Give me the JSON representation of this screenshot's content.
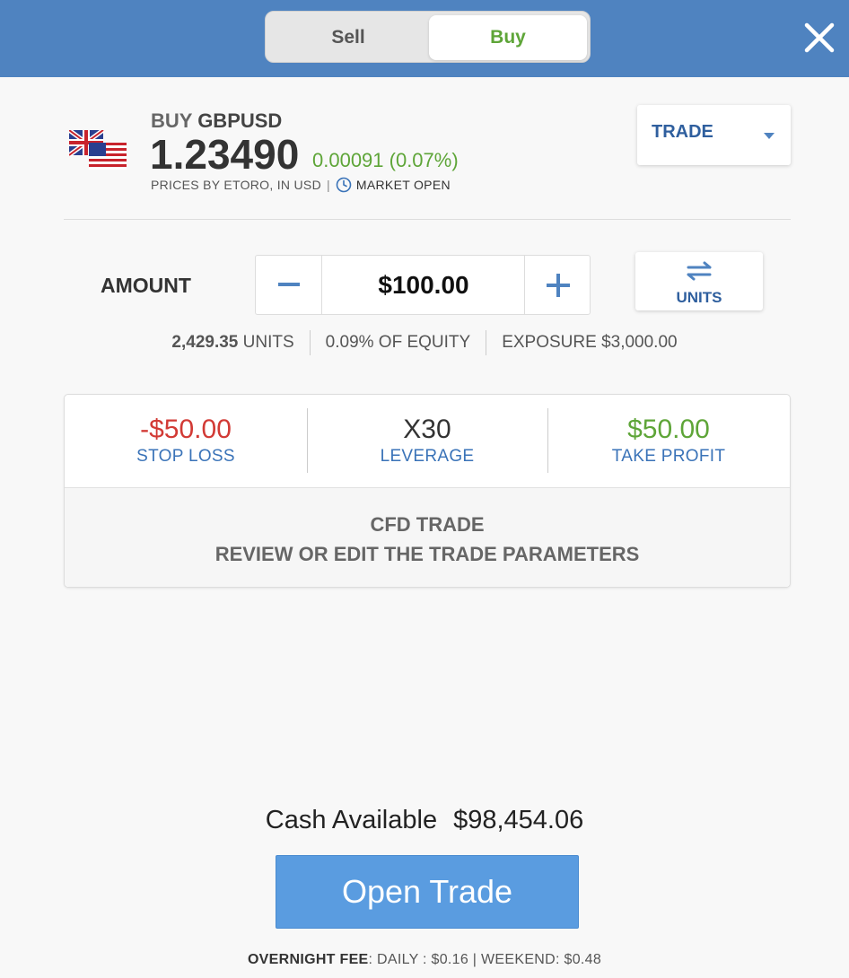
{
  "header": {
    "sell_label": "Sell",
    "buy_label": "Buy",
    "active": "Buy"
  },
  "instrument": {
    "verb": "BUY",
    "symbol": "GBPUSD",
    "price": "1.23490",
    "change": "0.00091 (0.07%)",
    "prices_by": "PRICES BY ETORO, IN USD",
    "separator": "|",
    "market_status": "MARKET OPEN"
  },
  "mode_dropdown": {
    "selected": "TRADE"
  },
  "amount": {
    "label": "AMOUNT",
    "value": "$100.00",
    "units_button_label": "UNITS",
    "units_value": "2,429.35",
    "units_suffix": "UNITS",
    "equity": "0.09% OF EQUITY",
    "exposure": "EXPOSURE $3,000.00"
  },
  "params": {
    "stop_loss_value": "-$50.00",
    "stop_loss_label": "STOP LOSS",
    "leverage_value": "X30",
    "leverage_label": "LEVERAGE",
    "take_profit_value": "$50.00",
    "take_profit_label": "TAKE PROFIT",
    "cfd_title": "CFD TRADE",
    "cfd_subtitle": "REVIEW OR EDIT THE TRADE PARAMETERS"
  },
  "footer": {
    "cash_label": "Cash Available",
    "cash_value": "$98,454.06",
    "open_button": "Open Trade",
    "fee_label": "OVERNIGHT FEE",
    "fee_daily": ": DAILY : $0.16 | WEEKEND: $0.48"
  },
  "colors": {
    "header_bg": "#4f83c0",
    "positive": "#5ea538",
    "negative": "#d23a35",
    "link_blue": "#3a73b8",
    "primary_button": "#5a9ce0"
  },
  "icons": {
    "close": "close-icon",
    "flags": "gbp-usd-flags-icon",
    "clock": "clock-icon",
    "swap": "swap-arrows-icon",
    "caret": "chevron-down-icon"
  }
}
